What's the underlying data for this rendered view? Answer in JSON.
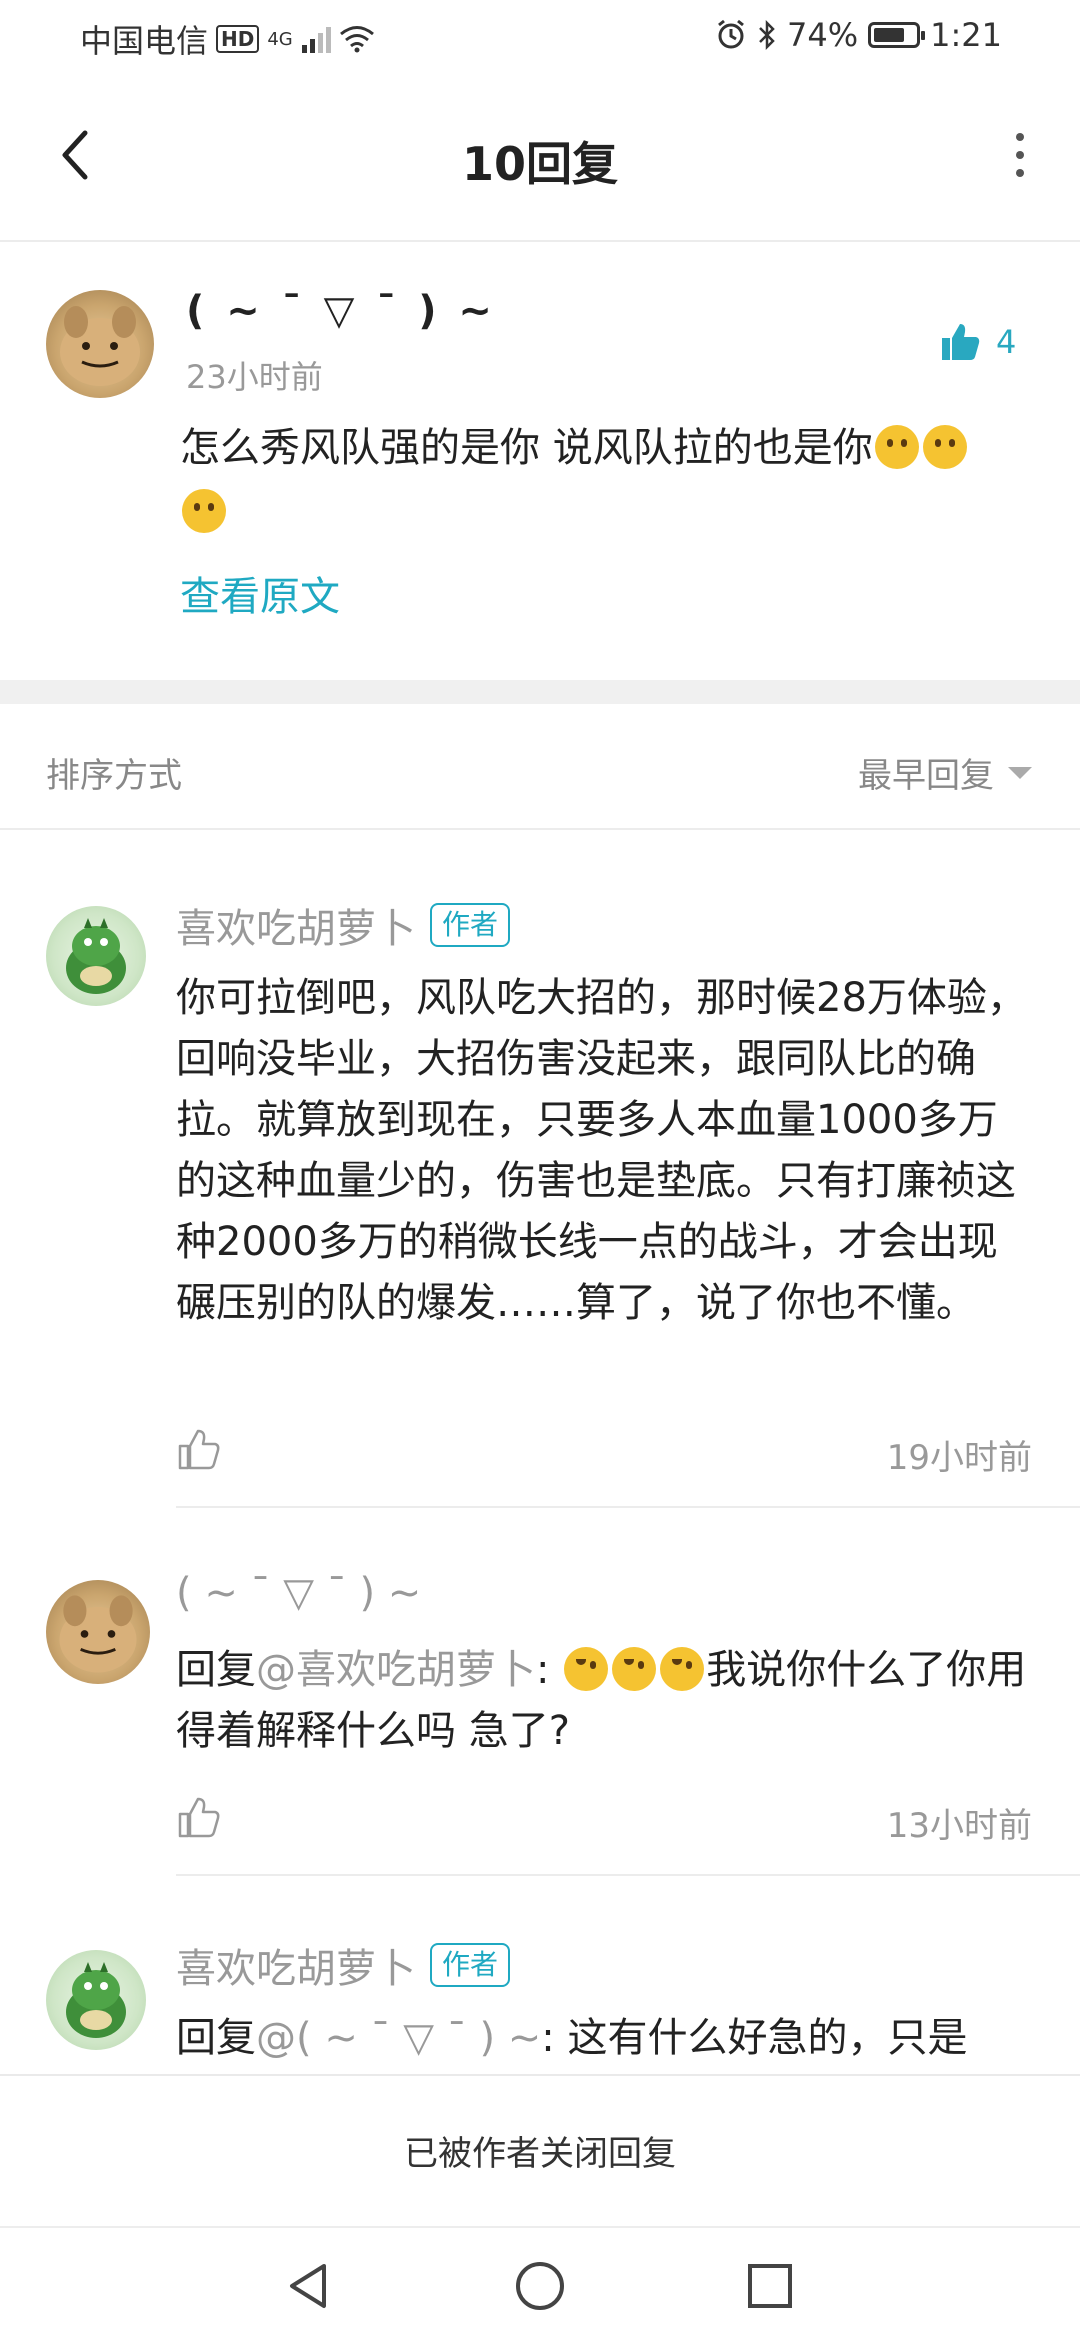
{
  "status_bar": {
    "carrier": "中国电信",
    "hd": "HD",
    "network": "4G",
    "battery": "74%",
    "battery_level": 0.74,
    "time": "1:21"
  },
  "header": {
    "title": "10回复"
  },
  "main_comment": {
    "author": "( ~ ¯ ▽ ¯ ) ~",
    "time": "23小时前",
    "likes": "4",
    "text": "怎么秀风队强的是你 说风队拉的也是你",
    "view_original": "查看原文"
  },
  "sort": {
    "label": "排序方式",
    "value": "最早回复"
  },
  "replies": [
    {
      "author": "喜欢吃胡萝卜",
      "badge": "作者",
      "text": "你可拉倒吧，风队吃大招的，那时候28万体验，回响没毕业，大招伤害没起来，跟同队比的确拉。就算放到现在，只要多人本血量1000多万的这种血量少的，伤害也是垫底。只有打廉祯这种2000多万的稍微长线一点的战斗，才会出现碾压别的队的爆发……算了，说了你也不懂。",
      "time": "19小时前"
    },
    {
      "author": "( ~ ¯ ▽ ¯ ) ~",
      "reply_prefix": "回复",
      "mention": "@喜欢吃胡萝卜",
      "colon": ": ",
      "text_after": "我说你什么了你用得着解释什么吗 急了?",
      "time": "13小时前"
    },
    {
      "author": "喜欢吃胡萝卜",
      "badge": "作者",
      "reply_prefix": "回复",
      "mention": "@( ~ ¯ ▽ ¯ ) ~",
      "colon": ": ",
      "text_after": "这有什么好急的，只是"
    }
  ],
  "closed_notice": "已被作者关闭回复",
  "icons": {
    "back": "back-arrow-icon",
    "more": "more-vertical-icon",
    "like": "thumbs-up-icon"
  },
  "colors": {
    "accent": "#1fa9c2",
    "text": "#222222",
    "muted": "#999999"
  }
}
